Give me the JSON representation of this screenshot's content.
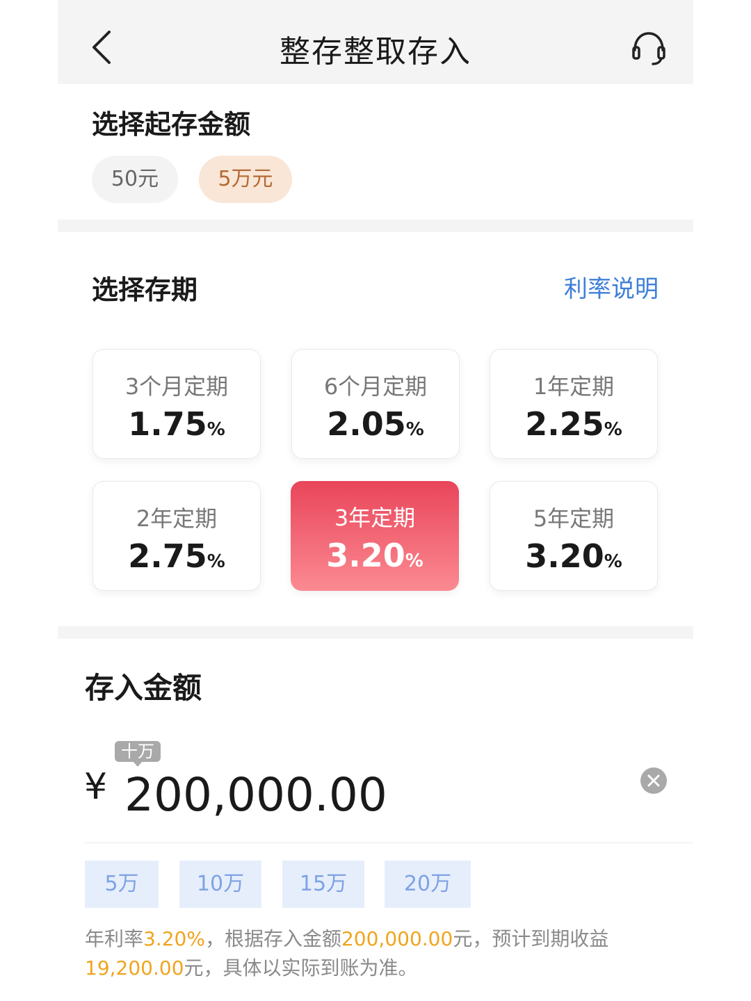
{
  "header": {
    "title": "整存整取存入"
  },
  "start_amount": {
    "title": "选择起存金额",
    "options": [
      "50元",
      "5万元"
    ],
    "selected_index": 1
  },
  "term": {
    "title": "选择存期",
    "rate_link": "利率说明",
    "percent_sign": "%",
    "cards": [
      {
        "term": "3个月定期",
        "rate": "1.75"
      },
      {
        "term": "6个月定期",
        "rate": "2.05"
      },
      {
        "term": "1年定期",
        "rate": "2.25"
      },
      {
        "term": "2年定期",
        "rate": "2.75"
      },
      {
        "term": "3年定期",
        "rate": "3.20"
      },
      {
        "term": "5年定期",
        "rate": "3.20"
      }
    ],
    "selected_index": 4
  },
  "deposit": {
    "title": "存入金额",
    "unit_tip": "十万",
    "currency": "¥",
    "amount": "200,000.00",
    "quick_amounts": [
      "5万",
      "10万",
      "15万",
      "20万"
    ],
    "note": {
      "p1": "年利率",
      "rate": "3.20%",
      "p2": "，根据存入金额",
      "amount": "200,000.00",
      "p3": "元，预计到期收益",
      "income": "19,200.00",
      "p4": "元，具体以实际到账为准。"
    }
  },
  "colors": {
    "selected_gradient_top": "#e9455a",
    "selected_gradient_bottom": "#fb8a92",
    "link_blue": "#3e7fd9",
    "highlight_orange": "#f0a41e"
  }
}
